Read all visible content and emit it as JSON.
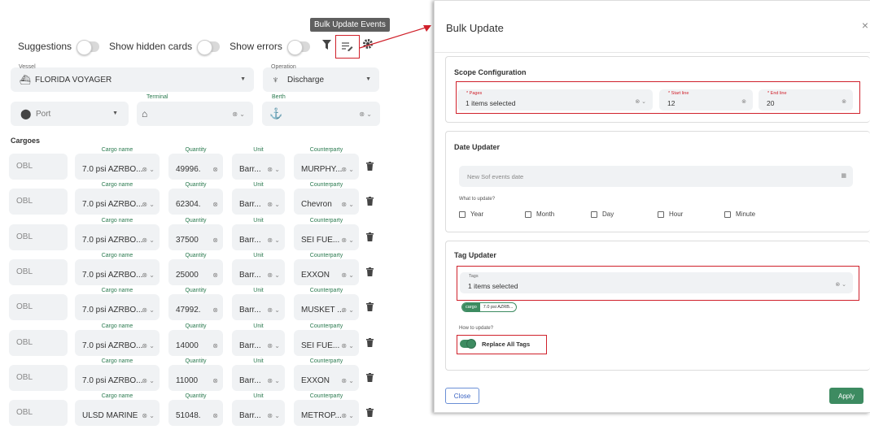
{
  "toolbar": {
    "suggestions_label": "Suggestions",
    "show_hidden_label": "Show hidden cards",
    "show_errors_label": "Show errors",
    "tooltip": "Bulk Update Events"
  },
  "form": {
    "vessel_label": "Vessel",
    "vessel_value": "FLORIDA VOYAGER",
    "operation_label": "Operation",
    "operation_value": "Discharge",
    "port_value": "Port",
    "terminal_label": "Terminal",
    "berth_label": "Berth"
  },
  "cargoes": {
    "title": "Cargoes",
    "labels": {
      "name": "Cargo name",
      "qty": "Quantity",
      "unit": "Unit",
      "cp": "Counterparty"
    },
    "rows": [
      {
        "type": "OBL",
        "name": "7.0 psi AZRBO...",
        "qty": "49996.",
        "unit": "Barr...",
        "cp": "MURPHY..."
      },
      {
        "type": "OBL",
        "name": "7.0 psi AZRBO...",
        "qty": "62304.",
        "unit": "Barr...",
        "cp": "Chevron"
      },
      {
        "type": "OBL",
        "name": "7.0 psi AZRBO...",
        "qty": "37500",
        "unit": "Barr...",
        "cp": "SEI FUE..."
      },
      {
        "type": "OBL",
        "name": "7.0 psi AZRBO...",
        "qty": "25000",
        "unit": "Barr...",
        "cp": "EXXON"
      },
      {
        "type": "OBL",
        "name": "7.0 psi AZRBO...",
        "qty": "47992.",
        "unit": "Barr...",
        "cp": "MUSKET ..."
      },
      {
        "type": "OBL",
        "name": "7.0 psi AZRBO...",
        "qty": "14000",
        "unit": "Barr...",
        "cp": "SEI FUE..."
      },
      {
        "type": "OBL",
        "name": "7.0 psi AZRBO...",
        "qty": "11000",
        "unit": "Barr...",
        "cp": "EXXON"
      },
      {
        "type": "OBL",
        "name": "ULSD MARINE",
        "qty": "51048.",
        "unit": "Barr...",
        "cp": "METROP..."
      }
    ]
  },
  "modal": {
    "title": "Bulk Update",
    "close": "×",
    "scope": {
      "title": "Scope Configuration",
      "pages_label": "* Pages",
      "pages_value": "1 items selected",
      "start_label": "* Start line",
      "start_value": "12",
      "end_label": "* End line",
      "end_value": "20"
    },
    "date": {
      "title": "Date Updater",
      "placeholder": "New Sof events date",
      "what_label": "What to update?",
      "options": [
        "Year",
        "Month",
        "Day",
        "Hour",
        "Minute"
      ]
    },
    "tag": {
      "title": "Tag Updater",
      "tags_label": "Tags",
      "tags_value": "1 items selected",
      "chip_key": "cargo",
      "chip_value": "7.0 psi AZRB...",
      "how_label": "How to update?",
      "replace_label": "Replace All Tags"
    },
    "close_button": "Close",
    "apply_button": "Apply"
  },
  "colors": {
    "accent": "#3d8b61",
    "highlight": "#d0212b"
  }
}
